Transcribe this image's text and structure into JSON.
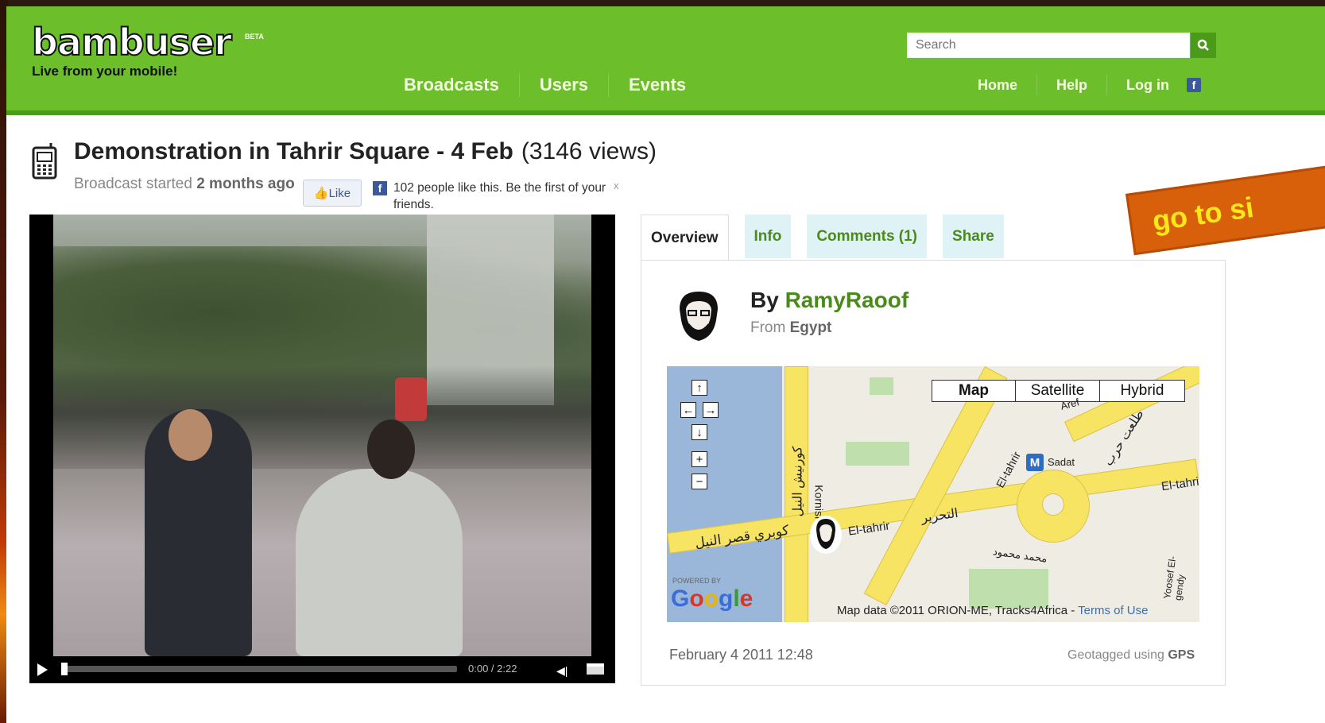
{
  "header": {
    "logo_text": "bambuser",
    "logo_beta": "BETA",
    "tagline": "Live from your mobile!",
    "search_placeholder": "Search",
    "main_nav": [
      "Broadcasts",
      "Users",
      "Events"
    ],
    "user_nav": [
      "Home",
      "Help",
      "Log in"
    ],
    "colors": {
      "header_bg": "#6cbe2a",
      "link_green": "#4a8a1a"
    }
  },
  "broadcast": {
    "title": "Demonstration in Tahrir Square - 4 Feb",
    "views": "(3146 views)",
    "started_prefix": "Broadcast started",
    "started_when": "2 months ago",
    "like_button": "Like",
    "like_text": "102 people like this. Be the first of your friends.",
    "like_close": "x"
  },
  "player": {
    "time": "0:00 / 2:22",
    "progress": 0.0
  },
  "tabs": [
    {
      "label": "Overview",
      "active": true
    },
    {
      "label": "Info",
      "active": false
    },
    {
      "label": "Comments (1)",
      "active": false
    },
    {
      "label": "Share",
      "active": false
    }
  ],
  "overview": {
    "by_prefix": "By",
    "username": "RamyRaoof",
    "from_prefix": "From",
    "country": "Egypt",
    "date": "February 4 2011 12:48",
    "geo_prefix": "Geotagged using",
    "geo_method": "GPS"
  },
  "map": {
    "types": [
      "Map",
      "Satellite",
      "Hybrid"
    ],
    "controls": [
      "↑",
      "←",
      "→",
      "↓",
      "+",
      "−"
    ],
    "labels": [
      "كورنيش النيل",
      "Kornish",
      "كوبري قصر النيل",
      "El-tahrir",
      "التحرير",
      "El-tahrir",
      "Sadat",
      "طلعت حرب",
      "Aref",
      "El-tahri",
      "محمد محمود",
      "Yoosef El-gendy"
    ],
    "powered_by": "POWERED BY",
    "google": "Google",
    "map_data": "Map data ©2011 ORION-ME, Tracks4Africa -",
    "terms": "Terms of Use"
  },
  "promo": {
    "text": "go to si",
    "color": "#d8600a"
  }
}
